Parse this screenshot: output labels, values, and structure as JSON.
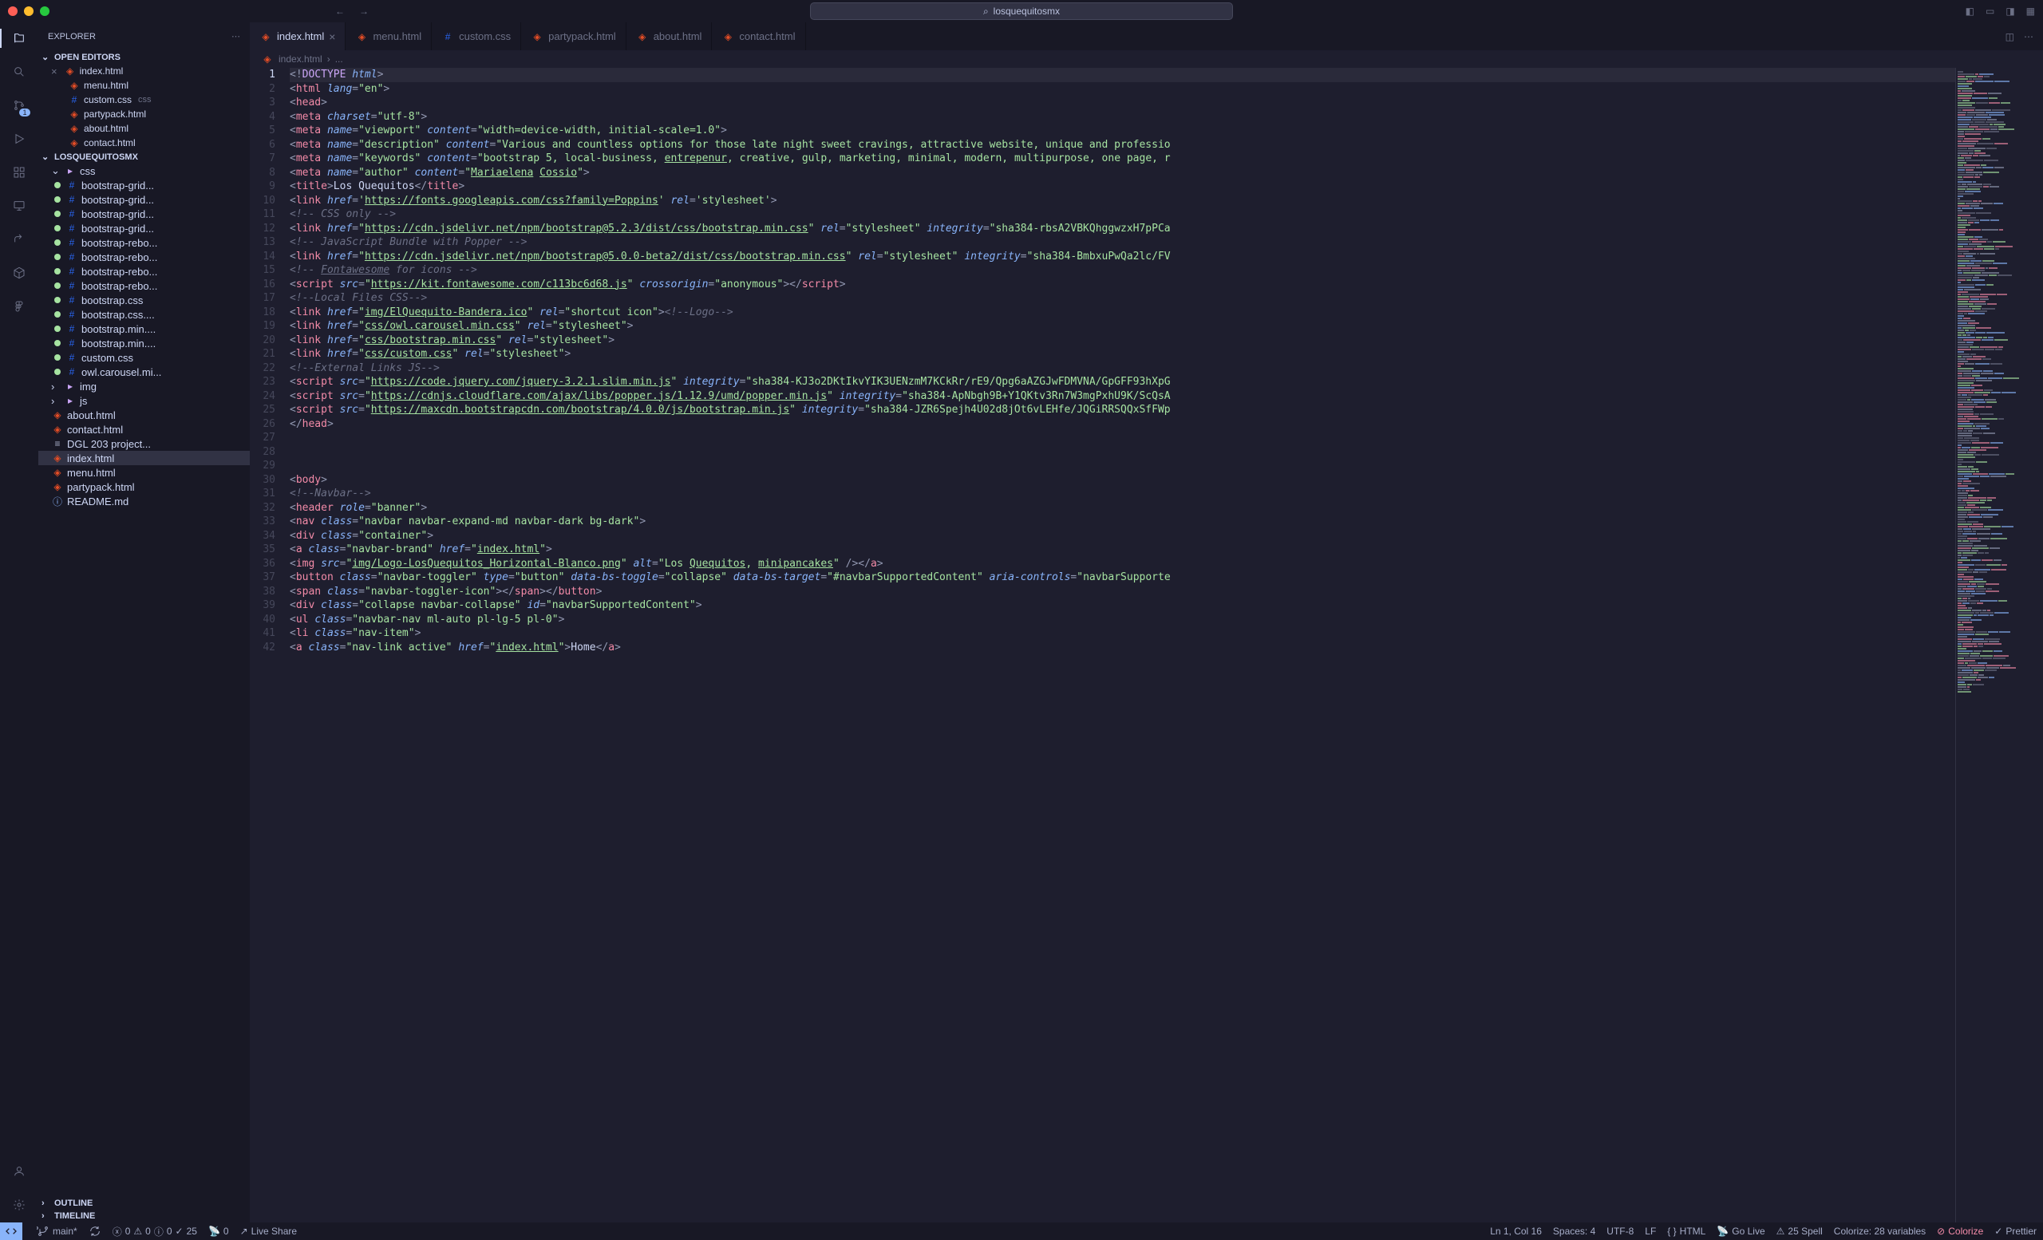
{
  "titlebar": {
    "search": "losquequitosmx"
  },
  "sidebar": {
    "title": "EXPLORER",
    "sections": {
      "openEditors": "OPEN EDITORS",
      "workspace": "LOSQUEQUITOSMX",
      "outline": "OUTLINE",
      "timeline": "TIMELINE"
    },
    "openEditors": [
      {
        "name": "index.html",
        "icon": "html",
        "close": true
      },
      {
        "name": "menu.html",
        "icon": "html"
      },
      {
        "name": "custom.css",
        "icon": "css",
        "suffix": "css"
      },
      {
        "name": "partypack.html",
        "icon": "html"
      },
      {
        "name": "about.html",
        "icon": "html"
      },
      {
        "name": "contact.html",
        "icon": "html"
      }
    ],
    "tree": [
      {
        "name": "css",
        "type": "folder",
        "indent": 1,
        "expanded": true
      },
      {
        "name": "bootstrap-grid...",
        "type": "css",
        "indent": 2,
        "git": "u"
      },
      {
        "name": "bootstrap-grid...",
        "type": "css",
        "indent": 2,
        "git": "u"
      },
      {
        "name": "bootstrap-grid...",
        "type": "css",
        "indent": 2,
        "git": "u"
      },
      {
        "name": "bootstrap-grid...",
        "type": "css",
        "indent": 2,
        "git": "u"
      },
      {
        "name": "bootstrap-rebo...",
        "type": "css",
        "indent": 2,
        "git": "u"
      },
      {
        "name": "bootstrap-rebo...",
        "type": "css",
        "indent": 2,
        "git": "u"
      },
      {
        "name": "bootstrap-rebo...",
        "type": "css",
        "indent": 2,
        "git": "u"
      },
      {
        "name": "bootstrap-rebo...",
        "type": "css",
        "indent": 2,
        "git": "u"
      },
      {
        "name": "bootstrap.css",
        "type": "css",
        "indent": 2,
        "git": "u"
      },
      {
        "name": "bootstrap.css....",
        "type": "css",
        "indent": 2,
        "git": "u"
      },
      {
        "name": "bootstrap.min....",
        "type": "css",
        "indent": 2,
        "git": "u"
      },
      {
        "name": "bootstrap.min....",
        "type": "css",
        "indent": 2,
        "git": "u"
      },
      {
        "name": "custom.css",
        "type": "css",
        "indent": 2,
        "git": "u"
      },
      {
        "name": "owl.carousel.mi...",
        "type": "css",
        "indent": 2,
        "git": "u"
      },
      {
        "name": "img",
        "type": "folder",
        "indent": 1,
        "expanded": false
      },
      {
        "name": "js",
        "type": "folder",
        "indent": 1,
        "expanded": false
      },
      {
        "name": "about.html",
        "type": "html",
        "indent": 1
      },
      {
        "name": "contact.html",
        "type": "html",
        "indent": 1
      },
      {
        "name": "DGL 203 project...",
        "type": "txt",
        "indent": 1
      },
      {
        "name": "index.html",
        "type": "html",
        "indent": 1,
        "selected": true
      },
      {
        "name": "menu.html",
        "type": "html",
        "indent": 1
      },
      {
        "name": "partypack.html",
        "type": "html",
        "indent": 1
      },
      {
        "name": "README.md",
        "type": "readme",
        "indent": 1
      }
    ]
  },
  "tabs": [
    {
      "name": "index.html",
      "icon": "html",
      "active": true,
      "close": true
    },
    {
      "name": "menu.html",
      "icon": "html"
    },
    {
      "name": "custom.css",
      "icon": "css"
    },
    {
      "name": "partypack.html",
      "icon": "html"
    },
    {
      "name": "about.html",
      "icon": "html"
    },
    {
      "name": "contact.html",
      "icon": "html"
    }
  ],
  "breadcrumb": {
    "file": "index.html",
    "more": "..."
  },
  "code": {
    "lines": [
      {
        "n": 1,
        "current": true,
        "html": "<span class='t-bracket'>&lt;!</span><span class='t-doctype'>DOCTYPE</span> <span class='t-attr'>html</span><span class='t-bracket'>&gt;</span>"
      },
      {
        "n": 2,
        "html": "<span class='t-bracket'>&lt;</span><span class='t-tag'>html</span> <span class='t-attr'>lang</span><span class='t-bracket'>=</span><span class='t-string'>\"en\"</span><span class='t-bracket'>&gt;</span>"
      },
      {
        "n": 3,
        "html": "<span class='t-bracket'>&lt;</span><span class='t-tag'>head</span><span class='t-bracket'>&gt;</span>"
      },
      {
        "n": 4,
        "html": "<span class='t-bracket'>&lt;</span><span class='t-tag'>meta</span> <span class='t-attr'>charset</span><span class='t-bracket'>=</span><span class='t-string'>\"utf-8\"</span><span class='t-bracket'>&gt;</span>"
      },
      {
        "n": 5,
        "html": "<span class='t-bracket'>&lt;</span><span class='t-tag'>meta</span> <span class='t-attr'>name</span><span class='t-bracket'>=</span><span class='t-string'>\"viewport\"</span> <span class='t-attr'>content</span><span class='t-bracket'>=</span><span class='t-string'>\"width=device-width, initial-scale=1.0\"</span><span class='t-bracket'>&gt;</span>"
      },
      {
        "n": 6,
        "html": "<span class='t-bracket'>&lt;</span><span class='t-tag'>meta</span> <span class='t-attr'>name</span><span class='t-bracket'>=</span><span class='t-string'>\"description\"</span> <span class='t-attr'>content</span><span class='t-bracket'>=</span><span class='t-string'>\"Various and countless options for those late night sweet cravings, attractive website, unique and professio</span>"
      },
      {
        "n": 7,
        "html": "<span class='t-bracket'>&lt;</span><span class='t-tag'>meta</span> <span class='t-attr'>name</span><span class='t-bracket'>=</span><span class='t-string'>\"keywords\"</span> <span class='t-attr'>content</span><span class='t-bracket'>=</span><span class='t-string'>\"bootstrap 5, local-business, <u>entrepenur</u>, creative, gulp, marketing, minimal, modern, multipurpose, one page, r</span>"
      },
      {
        "n": 8,
        "html": "<span class='t-bracket'>&lt;</span><span class='t-tag'>meta</span> <span class='t-attr'>name</span><span class='t-bracket'>=</span><span class='t-string'>\"author\"</span> <span class='t-attr'>content</span><span class='t-bracket'>=</span><span class='t-string'>\"<u>Mariaelena</u> <u>Cossio</u>\"</span><span class='t-bracket'>&gt;</span>"
      },
      {
        "n": 9,
        "html": "<span class='t-bracket'>&lt;</span><span class='t-tag'>title</span><span class='t-bracket'>&gt;</span><span class='t-text'>Los Quequitos</span><span class='t-bracket'>&lt;/</span><span class='t-tag'>title</span><span class='t-bracket'>&gt;</span>"
      },
      {
        "n": 10,
        "html": "<span class='t-bracket'>&lt;</span><span class='t-tag'>link</span> <span class='t-attr'>href</span><span class='t-bracket'>=</span><span class='t-string'>'</span><span class='t-url'>https://fonts.googleapis.com/css?family=Poppins</span><span class='t-string'>'</span> <span class='t-attr'>rel</span><span class='t-bracket'>=</span><span class='t-string'>'stylesheet'</span><span class='t-bracket'>&gt;</span>"
      },
      {
        "n": 11,
        "html": "<span class='t-comment'>&lt;!-- CSS only --&gt;</span>"
      },
      {
        "n": 12,
        "html": "<span class='t-bracket'>&lt;</span><span class='t-tag'>link</span> <span class='t-attr'>href</span><span class='t-bracket'>=</span><span class='t-string'>\"</span><span class='t-url'>https://cdn.jsdelivr.net/npm/bootstrap@5.2.3/dist/css/bootstrap.min.css</span><span class='t-string'>\"</span> <span class='t-attr'>rel</span><span class='t-bracket'>=</span><span class='t-string'>\"stylesheet\"</span> <span class='t-attr'>integrity</span><span class='t-bracket'>=</span><span class='t-string'>\"sha384-rbsA2VBKQhggwzxH7pPCa</span>"
      },
      {
        "n": 13,
        "html": "<span class='t-comment'>&lt;!-- JavaScript Bundle with Popper --&gt;</span>"
      },
      {
        "n": 14,
        "html": "<span class='t-bracket'>&lt;</span><span class='t-tag'>link</span> <span class='t-attr'>href</span><span class='t-bracket'>=</span><span class='t-string'>\"</span><span class='t-url'>https://cdn.jsdelivr.net/npm/bootstrap@5.0.0-beta2/dist/css/bootstrap.min.css</span><span class='t-string'>\"</span> <span class='t-attr'>rel</span><span class='t-bracket'>=</span><span class='t-string'>\"stylesheet\"</span> <span class='t-attr'>integrity</span><span class='t-bracket'>=</span><span class='t-string'>\"sha384-BmbxuPwQa2lc/FV</span>"
      },
      {
        "n": 15,
        "html": "<span class='t-comment'>&lt;!-- <u>Fontawesome</u> for icons --&gt;</span>"
      },
      {
        "n": 16,
        "html": "<span class='t-bracket'>&lt;</span><span class='t-tag'>script</span> <span class='t-attr'>src</span><span class='t-bracket'>=</span><span class='t-string'>\"</span><span class='t-url'>https://kit.fontawesome.com/c113bc6d68.js</span><span class='t-string'>\"</span> <span class='t-attr'>crossorigin</span><span class='t-bracket'>=</span><span class='t-string'>\"anonymous\"</span><span class='t-bracket'>&gt;&lt;/</span><span class='t-tag'>script</span><span class='t-bracket'>&gt;</span>"
      },
      {
        "n": 17,
        "html": "<span class='t-comment'>&lt;!--Local Files CSS--&gt;</span>"
      },
      {
        "n": 18,
        "html": "<span class='t-bracket'>&lt;</span><span class='t-tag'>link</span> <span class='t-attr'>href</span><span class='t-bracket'>=</span><span class='t-string'>\"</span><span class='t-url'>img/ElQuequito-Bandera.ico</span><span class='t-string'>\"</span> <span class='t-attr'>rel</span><span class='t-bracket'>=</span><span class='t-string'>\"shortcut icon\"</span><span class='t-bracket'>&gt;</span><span class='t-comment'>&lt;!--Logo--&gt;</span>"
      },
      {
        "n": 19,
        "html": "<span class='t-bracket'>&lt;</span><span class='t-tag'>link</span> <span class='t-attr'>href</span><span class='t-bracket'>=</span><span class='t-string'>\"</span><span class='t-url'>css/owl.carousel.min.css</span><span class='t-string'>\"</span> <span class='t-attr'>rel</span><span class='t-bracket'>=</span><span class='t-string'>\"stylesheet\"</span><span class='t-bracket'>&gt;</span>"
      },
      {
        "n": 20,
        "html": "<span class='t-bracket'>&lt;</span><span class='t-tag'>link</span> <span class='t-attr'>href</span><span class='t-bracket'>=</span><span class='t-string'>\"</span><span class='t-url'>css/bootstrap.min.css</span><span class='t-string'>\"</span> <span class='t-attr'>rel</span><span class='t-bracket'>=</span><span class='t-string'>\"stylesheet\"</span><span class='t-bracket'>&gt;</span>"
      },
      {
        "n": 21,
        "html": "<span class='t-bracket'>&lt;</span><span class='t-tag'>link</span> <span class='t-attr'>href</span><span class='t-bracket'>=</span><span class='t-string'>\"</span><span class='t-url'>css/custom.css</span><span class='t-string'>\"</span> <span class='t-attr'>rel</span><span class='t-bracket'>=</span><span class='t-string'>\"stylesheet\"</span><span class='t-bracket'>&gt;</span>"
      },
      {
        "n": 22,
        "html": "<span class='t-comment'>&lt;!--External Links JS--&gt;</span>"
      },
      {
        "n": 23,
        "html": "<span class='t-bracket'>&lt;</span><span class='t-tag'>script</span> <span class='t-attr'>src</span><span class='t-bracket'>=</span><span class='t-string'>\"</span><span class='t-url'>https://code.jquery.com/jquery-3.2.1.slim.min.js</span><span class='t-string'>\"</span> <span class='t-attr'>integrity</span><span class='t-bracket'>=</span><span class='t-string'>\"sha384-KJ3o2DKtIkvYIK3UENzmM7KCkRr/rE9/Qpg6aAZGJwFDMVNA/GpGFF93hXpG</span>"
      },
      {
        "n": 24,
        "html": "<span class='t-bracket'>&lt;</span><span class='t-tag'>script</span> <span class='t-attr'>src</span><span class='t-bracket'>=</span><span class='t-string'>\"</span><span class='t-url'>https://cdnjs.cloudflare.com/ajax/libs/popper.js/1.12.9/umd/popper.min.js</span><span class='t-string'>\"</span> <span class='t-attr'>integrity</span><span class='t-bracket'>=</span><span class='t-string'>\"sha384-ApNbgh9B+Y1QKtv3Rn7W3mgPxhU9K/ScQsA</span>"
      },
      {
        "n": 25,
        "html": "<span class='t-bracket'>&lt;</span><span class='t-tag'>script</span> <span class='t-attr'>src</span><span class='t-bracket'>=</span><span class='t-string'>\"</span><span class='t-url'>https://maxcdn.bootstrapcdn.com/bootstrap/4.0.0/js/bootstrap.min.js</span><span class='t-string'>\"</span> <span class='t-attr'>integrity</span><span class='t-bracket'>=</span><span class='t-string'>\"sha384-JZR6Spejh4U02d8jOt6vLEHfe/JQGiRRSQQxSfFWp</span>"
      },
      {
        "n": 26,
        "html": "<span class='t-bracket'>&lt;/</span><span class='t-tag'>head</span><span class='t-bracket'>&gt;</span>"
      },
      {
        "n": 27,
        "html": ""
      },
      {
        "n": 28,
        "html": ""
      },
      {
        "n": 29,
        "html": ""
      },
      {
        "n": 30,
        "html": "<span class='t-bracket'>&lt;</span><span class='t-tag'>body</span><span class='t-bracket'>&gt;</span>"
      },
      {
        "n": 31,
        "html": "<span class='t-comment'>&lt;!--Navbar--&gt;</span>"
      },
      {
        "n": 32,
        "html": "<span class='t-bracket'>&lt;</span><span class='t-tag'>header</span> <span class='t-attr'>role</span><span class='t-bracket'>=</span><span class='t-string'>\"banner\"</span><span class='t-bracket'>&gt;</span>"
      },
      {
        "n": 33,
        "html": "<span class='t-bracket'>&lt;</span><span class='t-tag'>nav</span> <span class='t-attr'>class</span><span class='t-bracket'>=</span><span class='t-string'>\"navbar navbar-expand-md navbar-dark bg-dark\"</span><span class='t-bracket'>&gt;</span>"
      },
      {
        "n": 34,
        "html": "<span class='t-bracket'>&lt;</span><span class='t-tag'>div</span> <span class='t-attr'>class</span><span class='t-bracket'>=</span><span class='t-string'>\"container\"</span><span class='t-bracket'>&gt;</span>"
      },
      {
        "n": 35,
        "html": "<span class='t-bracket'>&lt;</span><span class='t-tag'>a</span> <span class='t-attr'>class</span><span class='t-bracket'>=</span><span class='t-string'>\"navbar-brand\"</span> <span class='t-attr'>href</span><span class='t-bracket'>=</span><span class='t-string'>\"</span><span class='t-url'>index.html</span><span class='t-string'>\"</span><span class='t-bracket'>&gt;</span>"
      },
      {
        "n": 36,
        "html": "<span class='t-bracket'>&lt;</span><span class='t-tag'>img</span> <span class='t-attr'>src</span><span class='t-bracket'>=</span><span class='t-string'>\"</span><span class='t-url'>img/Logo-LosQuequitos_Horizontal-Blanco.png</span><span class='t-string'>\"</span> <span class='t-attr'>alt</span><span class='t-bracket'>=</span><span class='t-string'>\"Los <u>Quequitos</u>, <u>minipancakes</u>\"</span> <span class='t-bracket'>/&gt;&lt;/</span><span class='t-tag'>a</span><span class='t-bracket'>&gt;</span>"
      },
      {
        "n": 37,
        "html": "<span class='t-bracket'>&lt;</span><span class='t-tag'>button</span> <span class='t-attr'>class</span><span class='t-bracket'>=</span><span class='t-string'>\"navbar-toggler\"</span> <span class='t-attr'>type</span><span class='t-bracket'>=</span><span class='t-string'>\"button\"</span> <span class='t-attr'>data-bs-toggle</span><span class='t-bracket'>=</span><span class='t-string'>\"collapse\"</span> <span class='t-attr'>data-bs-target</span><span class='t-bracket'>=</span><span class='t-string'>\"#navbarSupportedContent\"</span> <span class='t-attr'>aria-controls</span><span class='t-bracket'>=</span><span class='t-string'>\"navbarSupporte</span>"
      },
      {
        "n": 38,
        "html": "<span class='t-bracket'>&lt;</span><span class='t-tag'>span</span> <span class='t-attr'>class</span><span class='t-bracket'>=</span><span class='t-string'>\"navbar-toggler-icon\"</span><span class='t-bracket'>&gt;&lt;/</span><span class='t-tag'>span</span><span class='t-bracket'>&gt;&lt;/</span><span class='t-tag'>button</span><span class='t-bracket'>&gt;</span>"
      },
      {
        "n": 39,
        "html": "<span class='t-bracket'>&lt;</span><span class='t-tag'>div</span> <span class='t-attr'>class</span><span class='t-bracket'>=</span><span class='t-string'>\"collapse navbar-collapse\"</span> <span class='t-attr'>id</span><span class='t-bracket'>=</span><span class='t-string'>\"navbarSupportedContent\"</span><span class='t-bracket'>&gt;</span>"
      },
      {
        "n": 40,
        "html": "<span class='t-bracket'>&lt;</span><span class='t-tag'>ul</span> <span class='t-attr'>class</span><span class='t-bracket'>=</span><span class='t-string'>\"navbar-nav ml-auto pl-lg-5 pl-0\"</span><span class='t-bracket'>&gt;</span>"
      },
      {
        "n": 41,
        "html": "<span class='t-bracket'>&lt;</span><span class='t-tag'>li</span> <span class='t-attr'>class</span><span class='t-bracket'>=</span><span class='t-string'>\"nav-item\"</span><span class='t-bracket'>&gt;</span>"
      },
      {
        "n": 42,
        "html": "<span class='t-bracket'>&lt;</span><span class='t-tag'>a</span> <span class='t-attr'>class</span><span class='t-bracket'>=</span><span class='t-string'>\"nav-link active\"</span> <span class='t-attr'>href</span><span class='t-bracket'>=</span><span class='t-string'>\"</span><span class='t-url'>index.html</span><span class='t-string'>\"</span><span class='t-bracket'>&gt;</span><span class='t-text'>Home</span><span class='t-bracket'>&lt;/</span><span class='t-tag'>a</span><span class='t-bracket'>&gt;</span>"
      }
    ]
  },
  "statusbar": {
    "branch": "main*",
    "sync": "",
    "errors": "0",
    "warnings": "0",
    "w": "0",
    "todo": "25",
    "port": "0",
    "liveShare": "Live Share",
    "cursor": "Ln 1, Col 16",
    "spaces": "Spaces: 4",
    "encoding": "UTF-8",
    "eol": "LF",
    "lang": "HTML",
    "goLive": "Go Live",
    "spell": "25 Spell",
    "colorize": "Colorize: 28 variables",
    "colorizeBtn": "Colorize",
    "prettier": "Prettier"
  },
  "scm_badge": "1"
}
